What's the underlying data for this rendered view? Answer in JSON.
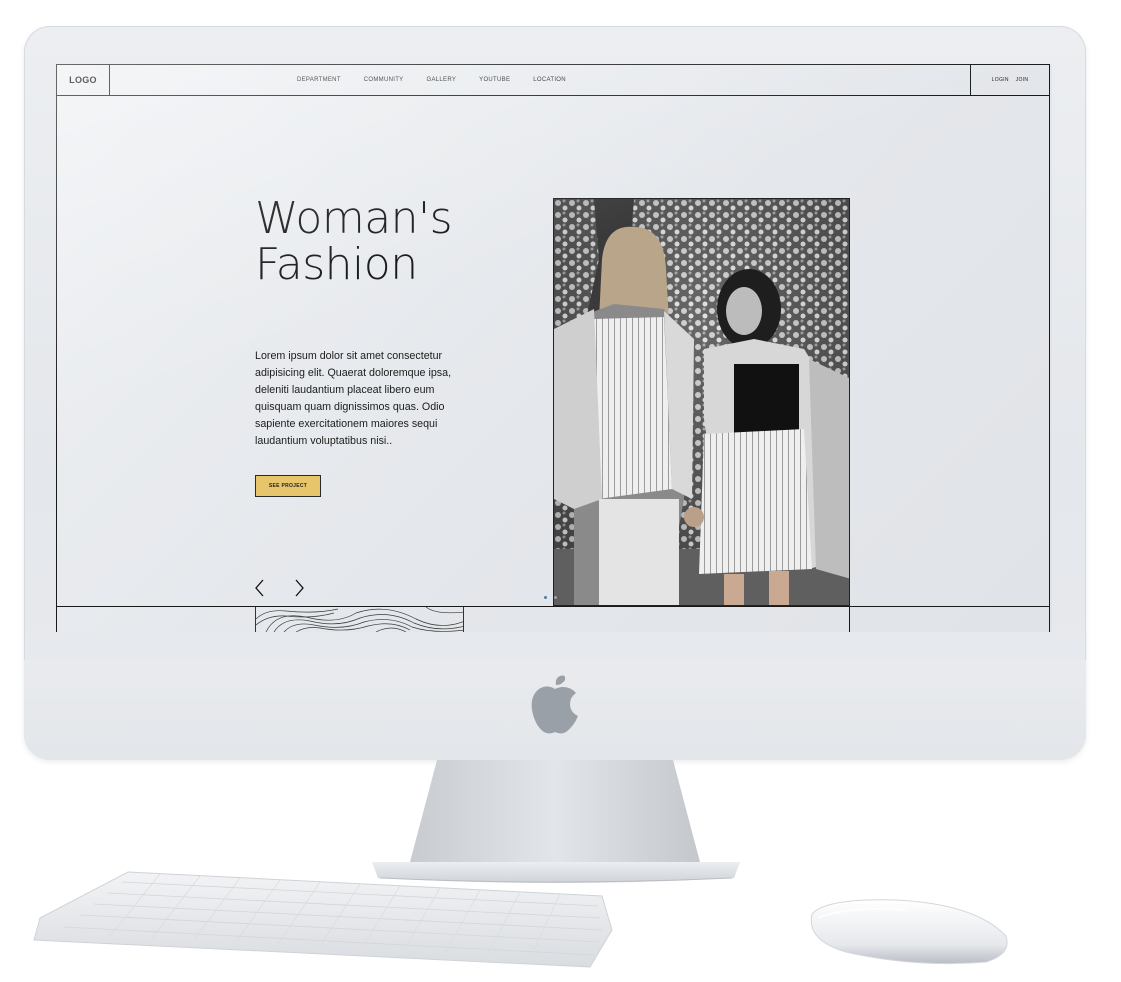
{
  "nav": {
    "logo": "LOGO",
    "links": [
      "DEPARTMENT",
      "COMMUNITY",
      "GALLERY",
      "YOUTUBE",
      "LOCATION"
    ],
    "login": "LOGIN",
    "join": "JOIN"
  },
  "hero": {
    "title": "Woman's\nFashion",
    "description": "Lorem ipsum dolor sit amet consectetur adipisicing elit. Quaerat doloremque ipsa, deleniti laudantium placeat libero eum quisquam quam dignissimos quas. Odio sapiente exercitationem maiores sequi laudantium voluptatibus nisi..",
    "button_label": "SEE PROJECT"
  },
  "carousel": {
    "slide_count": 2,
    "active_slide": 1
  },
  "icons": {
    "prev": "chevron-left-icon",
    "next": "chevron-right-icon",
    "brand": "apple-logo-icon"
  },
  "colors": {
    "accent": "#e6c56b",
    "ink": "#111111",
    "screen_bg": "#e8eaed",
    "active_dot": "#4f7db3"
  }
}
